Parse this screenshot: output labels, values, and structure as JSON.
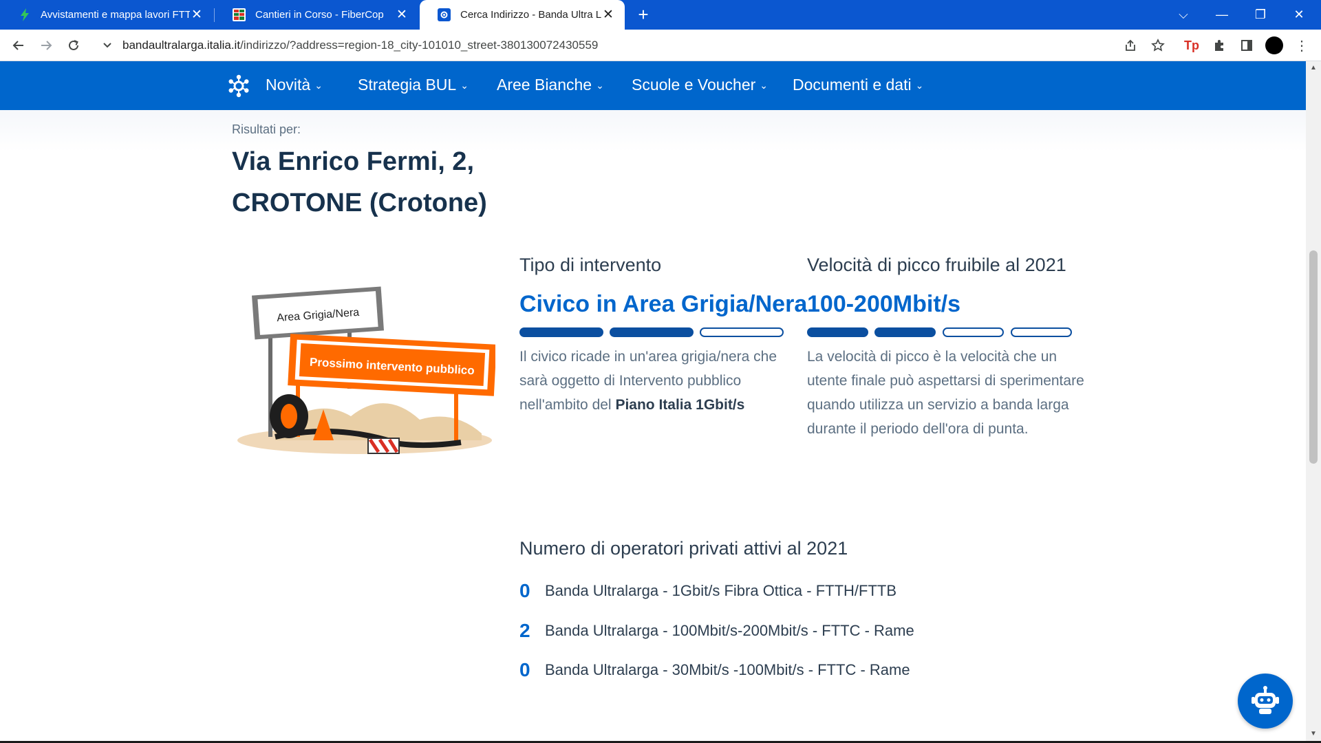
{
  "browser": {
    "tabs": [
      {
        "title": "Avvistamenti e mappa lavori FTTH",
        "icon": "bolt-icon",
        "active": false
      },
      {
        "title": "Cantieri in Corso - FiberCop",
        "icon": "grid-icon",
        "active": false
      },
      {
        "title": "Cerca Indirizzo - Banda Ultra Larga",
        "icon": "site-gear-icon",
        "active": true
      }
    ],
    "url_host": "bandaultralarga.italia.it",
    "url_path": "/indirizzo/?address=region-18_city-101010_street-380130072430559",
    "extension_label": "Tp"
  },
  "site": {
    "nav": [
      {
        "label": "Novità"
      },
      {
        "label": "Strategia BUL"
      },
      {
        "label": "Aree Bianche"
      },
      {
        "label": "Scuole e Voucher"
      },
      {
        "label": "Documenti e dati"
      }
    ]
  },
  "result": {
    "results_for": "Risultati per:",
    "address_line1": "Via Enrico Fermi, 2,",
    "address_line2": "CROTONE (Crotone)"
  },
  "illustration": {
    "sign_label": "Area Grigia/Nera",
    "banner_label": "Prossimo intervento pubblico"
  },
  "intervention": {
    "heading": "Tipo di intervento",
    "value": "Civico in Area Grigia/Nera",
    "level_filled": 2,
    "level_total": 3,
    "desc_text": "Il civico ricade in un'area grigia/nera che sarà oggetto di Intervento pubblico nell'ambito del ",
    "desc_bold": "Piano Italia 1Gbit/s"
  },
  "speed": {
    "heading": "Velocità di picco fruibile al 2021",
    "value": "100-200Mbit/s",
    "level_filled": 2,
    "level_total": 4,
    "description": "La velocità di picco è la velocità che un utente finale può aspettarsi di sperimentare quando utilizza un servizio a banda larga durante il periodo dell'ora di punta."
  },
  "operators": {
    "heading": "Numero di operatori privati attivi al 2021",
    "rows": [
      {
        "count": "0",
        "label": "Banda Ultralarga - 1Gbit/s Fibra Ottica - FTTH/FTTB"
      },
      {
        "count": "2",
        "label": "Banda Ultralarga - 100Mbit/s-200Mbit/s - FTTC - Rame"
      },
      {
        "count": "0",
        "label": "Banda Ultralarga - 30Mbit/s -100Mbit/s - FTTC - Rame"
      }
    ]
  },
  "colors": {
    "chrome_blue": "#0b57d0",
    "site_blue": "#0066cc",
    "bar_blue": "#0b4fa0",
    "title_navy": "#17324d",
    "banner_orange": "#ff6a00"
  }
}
